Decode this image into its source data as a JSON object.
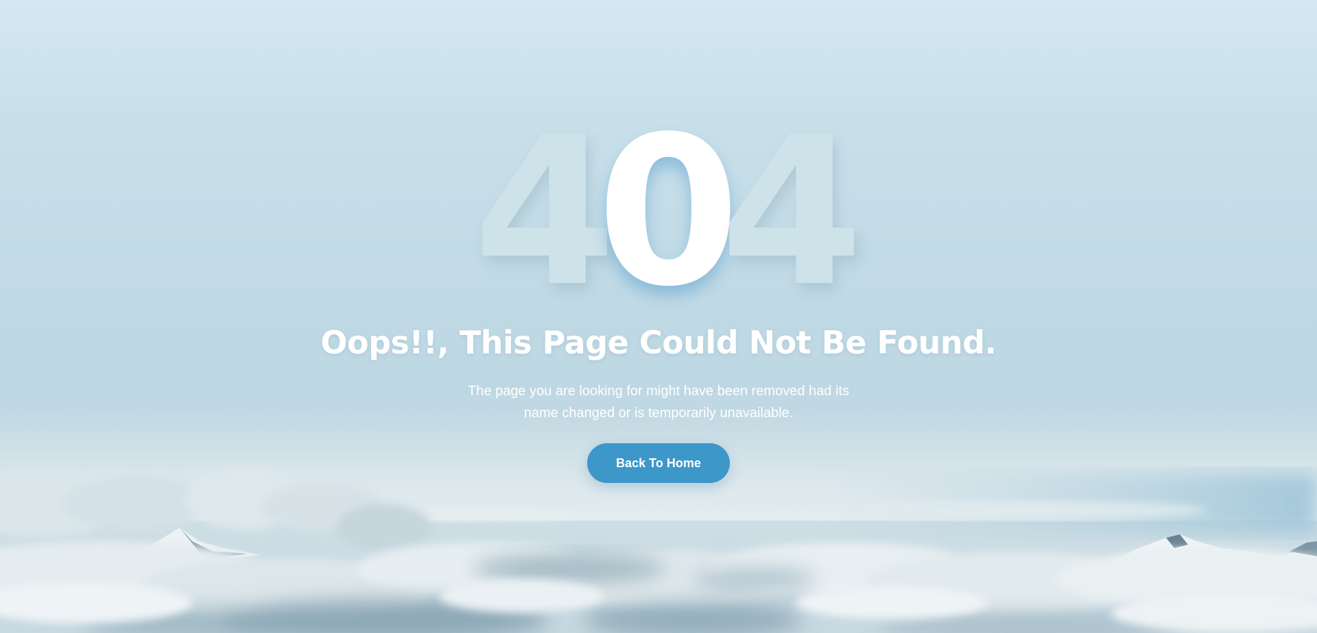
{
  "error": {
    "code_digits": [
      "4",
      "0",
      "4"
    ],
    "headline": "Oops!!, This Page Could Not Be Found.",
    "description_line1": "The page you are looking for might have been removed had its",
    "description_line2": "name changed or is temporarily unavailable.",
    "button_label": "Back To Home"
  },
  "colors": {
    "sky_top": "#d4e8f1",
    "sky_mid": "#c2dbe6",
    "button": "#3d97c8",
    "faded_digit": "#cee2ea",
    "text": "#ffffff"
  },
  "background": {
    "scene": "sky-above-clouds-with-snowy-peaks"
  }
}
